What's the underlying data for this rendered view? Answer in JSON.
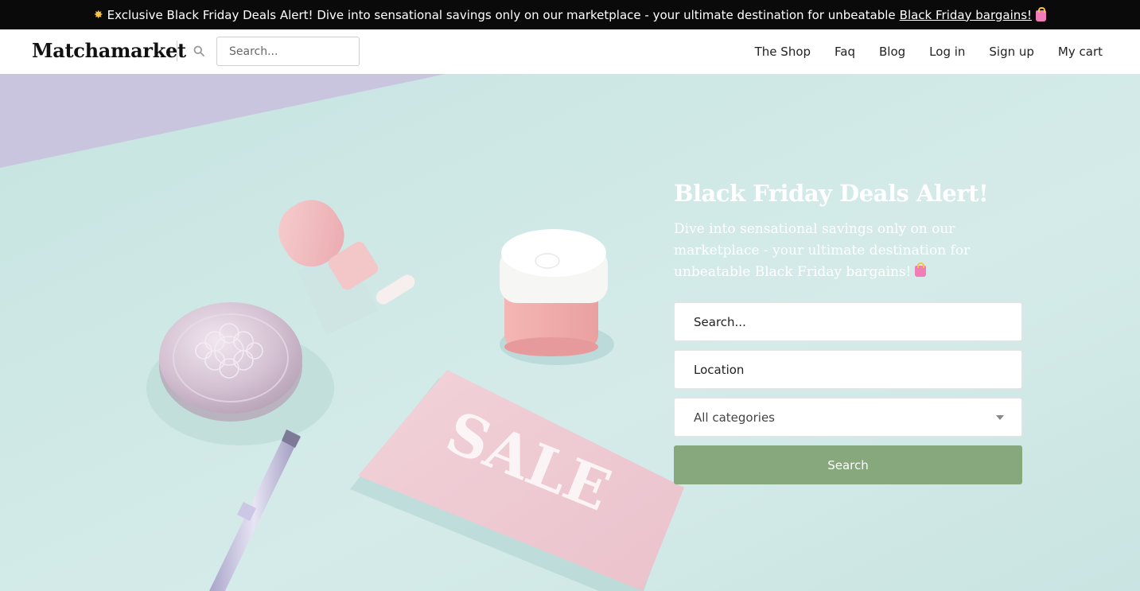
{
  "announcement": {
    "text": "Exclusive Black Friday Deals Alert! Dive into sensational savings only on our marketplace - your ultimate destination for unbeatable",
    "link_text": "Black Friday bargains!"
  },
  "header": {
    "logo": "Matchamarket",
    "search_placeholder": "Search...",
    "nav": [
      "The Shop",
      "Faq",
      "Blog",
      "Log in",
      "Sign up",
      "My cart"
    ]
  },
  "hero": {
    "title": "Black Friday Deals Alert!",
    "subtitle": "Dive into sensational savings only on our marketplace - your ultimate destination for unbeatable Black Friday bargains!",
    "image_text": "SALE",
    "search_placeholder": "Search...",
    "location_placeholder": "Location",
    "category_selected": "All categories",
    "search_button": "Search"
  },
  "colors": {
    "announcement_bg": "#0a0a0a",
    "hero_bg": "#cfe7e6",
    "button_bg": "#87a77c"
  }
}
